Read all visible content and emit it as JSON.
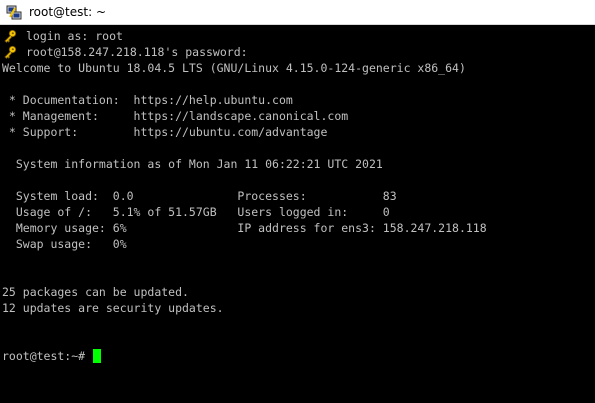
{
  "window": {
    "title": "root@test: ~",
    "icon": "putty-icon"
  },
  "terminal": {
    "lines": [
      {
        "id": "login",
        "text": "login as: root",
        "icon": "key-icon"
      },
      {
        "id": "password",
        "text": "root@158.247.218.118's password:",
        "icon": "key-icon"
      },
      {
        "id": "welcome",
        "text": "Welcome to Ubuntu 18.04.5 LTS (GNU/Linux 4.15.0-124-generic x86_64)"
      },
      {
        "id": "blank1",
        "text": ""
      },
      {
        "id": "doc",
        "text": " * Documentation:  https://help.ubuntu.com"
      },
      {
        "id": "mgmt",
        "text": " * Management:     https://landscape.canonical.com"
      },
      {
        "id": "support",
        "text": " * Support:        https://ubuntu.com/advantage"
      },
      {
        "id": "blank2",
        "text": ""
      },
      {
        "id": "sysinfo",
        "text": "  System information as of Mon Jan 11 06:22:21 UTC 2021"
      },
      {
        "id": "blank3",
        "text": ""
      },
      {
        "id": "load",
        "text": "  System load:  0.0               Processes:           83"
      },
      {
        "id": "usage",
        "text": "  Usage of /:   5.1% of 51.57GB   Users logged in:     0"
      },
      {
        "id": "memory",
        "text": "  Memory usage: 6%                IP address for ens3: 158.247.218.118"
      },
      {
        "id": "swap",
        "text": "  Swap usage:   0%"
      },
      {
        "id": "blank4",
        "text": ""
      },
      {
        "id": "blank5",
        "text": ""
      },
      {
        "id": "packages",
        "text": "25 packages can be updated."
      },
      {
        "id": "security",
        "text": "12 updates are security updates."
      },
      {
        "id": "blank6",
        "text": ""
      },
      {
        "id": "blank7",
        "text": ""
      },
      {
        "id": "prompt",
        "text": "root@test:~# "
      }
    ],
    "cursor_color": "#00ff00",
    "text_color": "#c0c0c0",
    "background": "#000000"
  }
}
